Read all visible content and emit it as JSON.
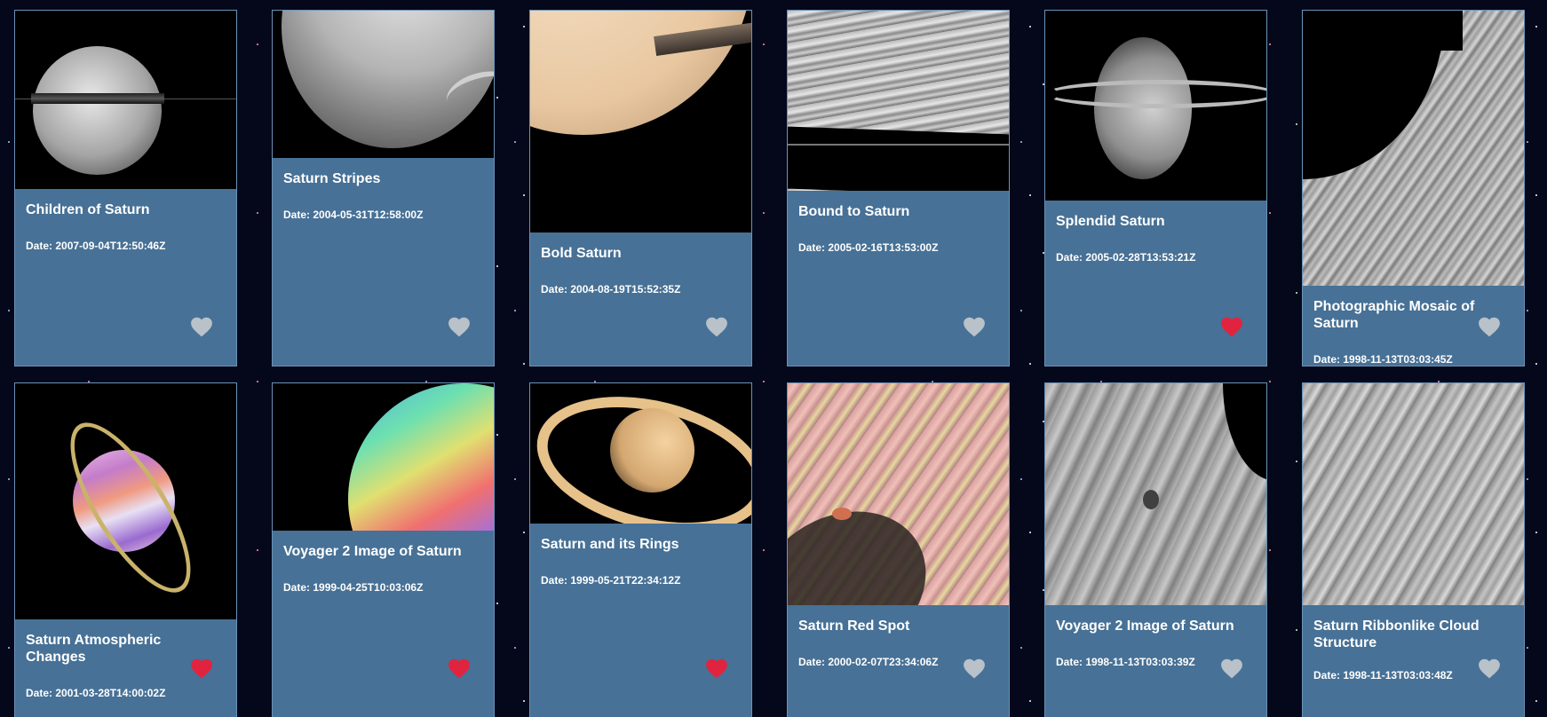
{
  "cards": [
    {
      "title": "Children of Saturn",
      "date": "Date: 2007-09-04T12:50:46Z",
      "liked": false
    },
    {
      "title": "Saturn Stripes",
      "date": "Date: 2004-05-31T12:58:00Z",
      "liked": false
    },
    {
      "title": "Bold Saturn",
      "date": "Date: 2004-08-19T15:52:35Z",
      "liked": false
    },
    {
      "title": "Bound to Saturn",
      "date": "Date: 2005-02-16T13:53:00Z",
      "liked": false
    },
    {
      "title": "Splendid Saturn",
      "date": "Date: 2005-02-28T13:53:21Z",
      "liked": true
    },
    {
      "title": "Photographic Mosaic of Saturn",
      "date": "Date: 1998-11-13T03:03:45Z",
      "liked": false
    },
    {
      "title": "Saturn Atmospheric Changes",
      "date": "Date: 2001-03-28T14:00:02Z",
      "liked": true
    },
    {
      "title": "Voyager 2 Image of Saturn",
      "date": "Date: 1999-04-25T10:03:06Z",
      "liked": true
    },
    {
      "title": "Saturn and its Rings",
      "date": "Date: 1999-05-21T22:34:12Z",
      "liked": true
    },
    {
      "title": "Saturn Red Spot",
      "date": "Date: 2000-02-07T23:34:06Z",
      "liked": false
    },
    {
      "title": "Voyager 2 Image of Saturn",
      "date": "Date: 1998-11-13T03:03:39Z",
      "liked": false
    },
    {
      "title": "Saturn Ribbonlike Cloud Structure",
      "date": "Date: 1998-11-13T03:03:48Z",
      "liked": false
    }
  ],
  "icons": {
    "like": "heart-icon"
  },
  "colors": {
    "card_bg": "#477196",
    "heart_off": "#b9c1c9",
    "heart_on": "#e0243f"
  }
}
